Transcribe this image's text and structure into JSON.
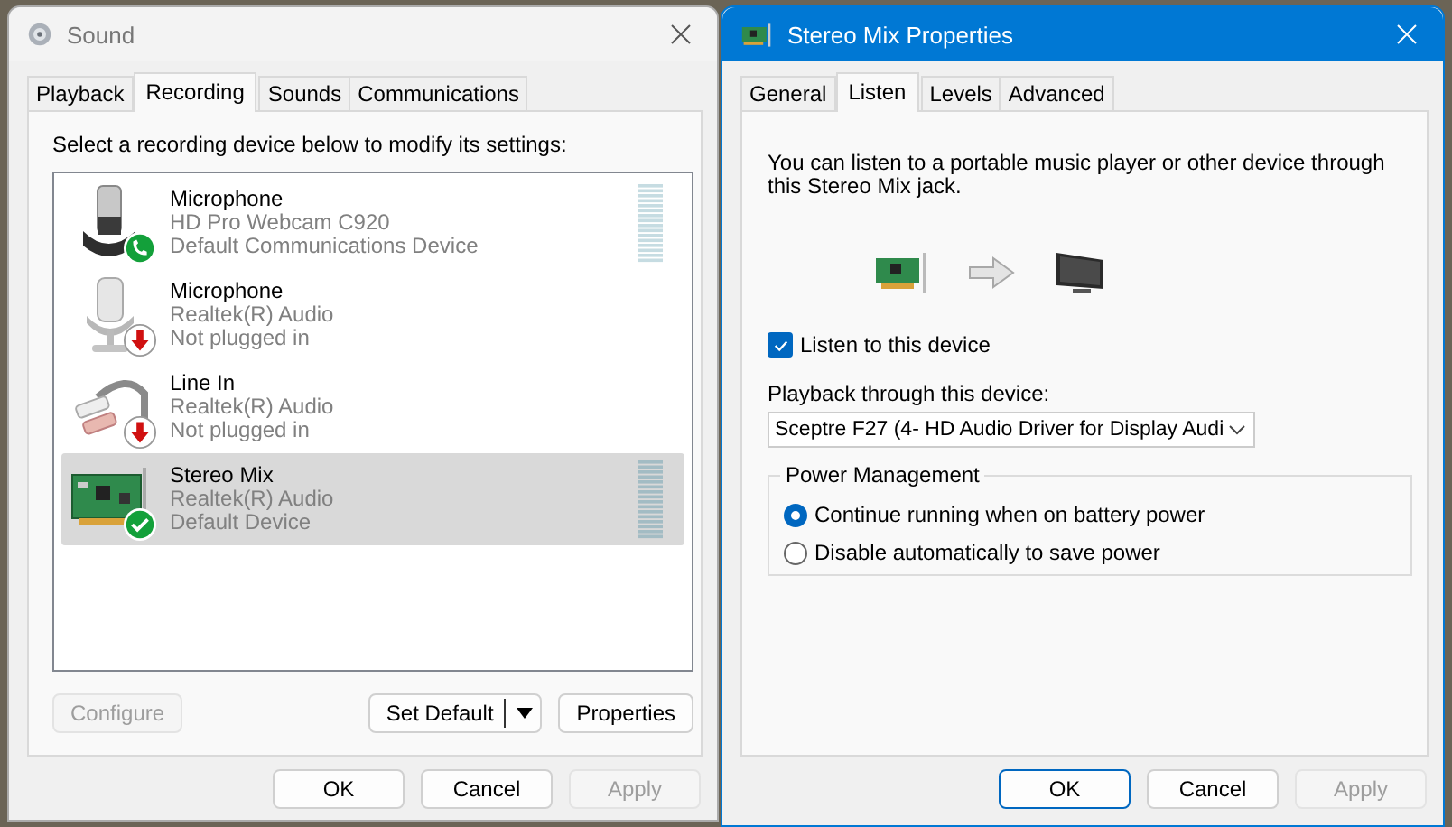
{
  "sound_window": {
    "title": "Sound",
    "active": false,
    "tabs": [
      {
        "label": "Playback",
        "selected": false
      },
      {
        "label": "Recording",
        "selected": true
      },
      {
        "label": "Sounds",
        "selected": false
      },
      {
        "label": "Communications",
        "selected": false
      }
    ],
    "instruction": "Select a recording device below to modify its settings:",
    "devices": [
      {
        "kind": "webcam-mic",
        "badge": {
          "kind": "phone"
        },
        "name": "Microphone",
        "description": "HD Pro Webcam C920",
        "status": "Default Communications Device",
        "meter": true,
        "selected": false
      },
      {
        "kind": "microphone",
        "badge": {
          "kind": "unplugged"
        },
        "name": "Microphone",
        "description": "Realtek(R) Audio",
        "status": "Not plugged in",
        "meter": false,
        "selected": false
      },
      {
        "kind": "line-in",
        "badge": {
          "kind": "unplugged"
        },
        "name": "Line In",
        "description": "Realtek(R) Audio",
        "status": "Not plugged in",
        "meter": false,
        "selected": false
      },
      {
        "kind": "sound-card",
        "badge": {
          "kind": "check"
        },
        "name": "Stereo Mix",
        "description": "Realtek(R) Audio",
        "status": "Default Device",
        "meter": true,
        "selected": true
      }
    ],
    "panel_buttons": [
      {
        "kind": "plain",
        "label": "Configure",
        "disabled": true
      },
      {
        "kind": "split",
        "label": "Set Default",
        "disabled": false
      },
      {
        "kind": "plain",
        "label": "Properties",
        "disabled": false
      }
    ],
    "buttons": [
      {
        "label": "OK",
        "disabled": false,
        "default": false
      },
      {
        "label": "Cancel",
        "disabled": false,
        "default": false
      },
      {
        "label": "Apply",
        "disabled": true,
        "default": false
      }
    ]
  },
  "properties_window": {
    "title": "Stereo Mix Properties",
    "active": true,
    "tabs": [
      {
        "label": "General",
        "selected": false
      },
      {
        "label": "Listen",
        "selected": true
      },
      {
        "label": "Levels",
        "selected": false
      },
      {
        "label": "Advanced",
        "selected": false
      }
    ],
    "description": "You can listen to a portable music player or other device through this Stereo Mix jack.",
    "listen_checkbox": {
      "label": "Listen to this device",
      "checked": true
    },
    "playback_label": "Playback through this device:",
    "playback_device": "Sceptre F27 (4- HD Audio Driver for Display Audi",
    "power_group": {
      "legend": "Power Management",
      "options": [
        {
          "label": "Continue running when on battery power",
          "selected": true
        },
        {
          "label": "Disable automatically to save power",
          "selected": false
        }
      ]
    },
    "buttons": [
      {
        "label": "OK",
        "disabled": false,
        "default": true
      },
      {
        "label": "Cancel",
        "disabled": false,
        "default": false
      },
      {
        "label": "Apply",
        "disabled": true,
        "default": false
      }
    ]
  }
}
